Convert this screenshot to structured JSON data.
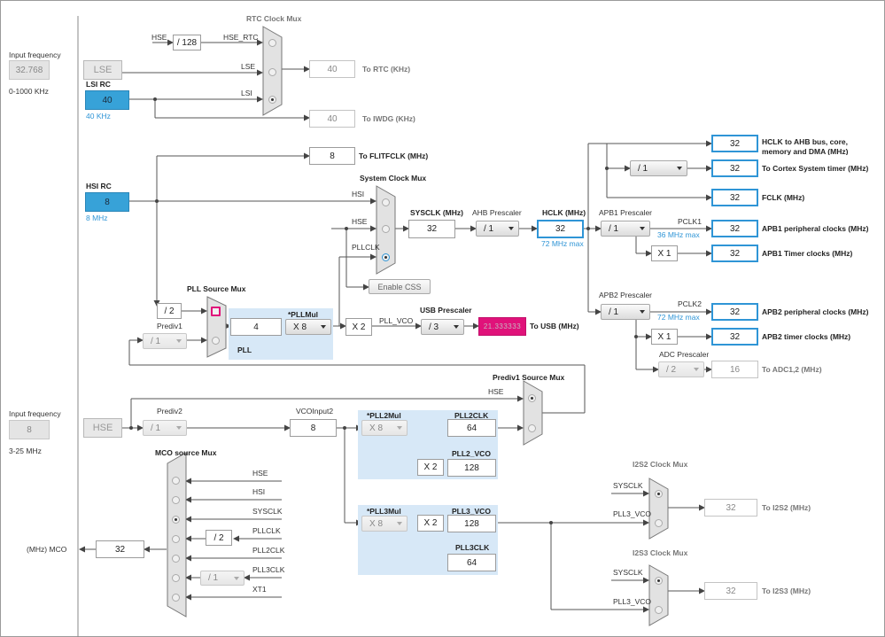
{
  "left": {
    "lse_input_label": "Input frequency",
    "lse_input_value": "32.768",
    "lse_range": "0-1000 KHz",
    "lse_label": "LSE",
    "lsi_rc_label": "LSI RC",
    "lsi_value": "40",
    "lsi_freq": "40 KHz",
    "hsi_rc_label": "HSI RC",
    "hsi_value": "8",
    "hsi_freq": "8 MHz",
    "hse_input_label": "Input frequency",
    "hse_input_value": "8",
    "hse_range": "3-25 MHz",
    "hse_label": "HSE",
    "mco_label": "(MHz) MCO",
    "mco_value": "32"
  },
  "rtc": {
    "title": "RTC Clock Mux",
    "hse_label": "HSE",
    "div128": "/ 128",
    "hse_rtc": "HSE_RTC",
    "lse": "LSE",
    "lsi": "LSI",
    "rtc_value": "40",
    "rtc_dest": "To RTC (KHz)",
    "iwdg_value": "40",
    "iwdg_dest": "To IWDG (KHz)",
    "flit_value": "8",
    "flit_dest": "To FLITFCLK (MHz)"
  },
  "sysmux": {
    "title": "System Clock Mux",
    "hsi": "HSI",
    "hse": "HSE",
    "pllclk": "PLLCLK",
    "enable_css": "Enable CSS",
    "sysclk_label": "SYSCLK (MHz)",
    "sysclk_value": "32",
    "ahb_label": "AHB Prescaler",
    "ahb_value": "/ 1",
    "hclk_label": "HCLK (MHz)",
    "hclk_value": "32",
    "hclk_max": "72 MHz max"
  },
  "apb": {
    "apb1_label": "APB1 Prescaler",
    "apb1_value": "/ 1",
    "pclk1": "PCLK1",
    "pclk1_max": "36 MHz max",
    "x1_a": "X 1",
    "apb2_label": "APB2 Prescaler",
    "apb2_value": "/ 1",
    "pclk2": "PCLK2",
    "pclk2_max": "72 MHz max",
    "x1_b": "X 1",
    "adc_label": "ADC Prescaler",
    "adc_value": "/ 2",
    "cortex_div": "/ 1"
  },
  "outputs": [
    {
      "value": "32",
      "dest": "HCLK to AHB bus, core,",
      "dest2": "memory and DMA (MHz)"
    },
    {
      "value": "32",
      "dest": "To Cortex System timer (MHz)",
      "dest2": ""
    },
    {
      "value": "32",
      "dest": "FCLK (MHz)",
      "dest2": ""
    },
    {
      "value": "32",
      "dest": "APB1 peripheral clocks (MHz)",
      "dest2": ""
    },
    {
      "value": "32",
      "dest": "APB1 Timer clocks (MHz)",
      "dest2": ""
    },
    {
      "value": "32",
      "dest": "APB2 peripheral clocks (MHz)",
      "dest2": ""
    },
    {
      "value": "32",
      "dest": "APB2 timer clocks (MHz)",
      "dest2": ""
    },
    {
      "value": "16",
      "dest": "To ADC1,2 (MHz)",
      "dest2": ""
    }
  ],
  "pll": {
    "src_mux_title": "PLL Source Mux",
    "div2": "/ 2",
    "prediv1_label": "Prediv1",
    "prediv1_value": "/ 1",
    "pll_label": "PLL",
    "pllmul_label": "*PLLMul",
    "pll_in_value": "4",
    "pllmul_value": "X 8",
    "x2": "X 2",
    "pll_vco": "PLL_VCO",
    "usb_label": "USB Prescaler",
    "usb_div": "/ 3",
    "usb_value": "21.333333",
    "usb_dest": "To USB (MHz)"
  },
  "prediv": {
    "prediv1_mux_title": "Prediv1 Source Mux",
    "hse": "HSE",
    "prediv2_label": "Prediv2",
    "prediv2_value": "/ 1",
    "vcoinput2_label": "VCOInput2",
    "vcoinput2_value": "8"
  },
  "pll2": {
    "mul_label": "*PLL2Mul",
    "mul_value": "X 8",
    "clk_label": "PLL2CLK",
    "clk_value": "64",
    "vco_label": "PLL2_VCO",
    "x2": "X 2",
    "vco_value": "128"
  },
  "pll3": {
    "mul_label": "*PLL3Mul",
    "mul_value": "X 8",
    "x2": "X 2",
    "vco_label": "PLL3_VCO",
    "vco_value": "128",
    "clk_label": "PLL3CLK",
    "clk_value": "64"
  },
  "mco": {
    "title": "MCO source Mux",
    "hse": "HSE",
    "hsi": "HSI",
    "sysclk": "SYSCLK",
    "pllclk": "PLLCLK",
    "div2": "/ 2",
    "pll2clk": "PLL2CLK",
    "pll3clk": "PLL3CLK",
    "div1": "/ 1",
    "xt1": "XT1"
  },
  "i2s": {
    "i2s2_title": "I2S2 Clock Mux",
    "i2s2_sysclk": "SYSCLK",
    "i2s2_pll3": "PLL3_VCO",
    "i2s2_value": "32",
    "i2s2_dest": "To I2S2 (MHz)",
    "i2s3_title": "I2S3 Clock Mux",
    "i2s3_sysclk": "SYSCLK",
    "i2s3_pll3": "PLL3_VCO",
    "i2s3_value": "32",
    "i2s3_dest": "To I2S3 (MHz)"
  }
}
